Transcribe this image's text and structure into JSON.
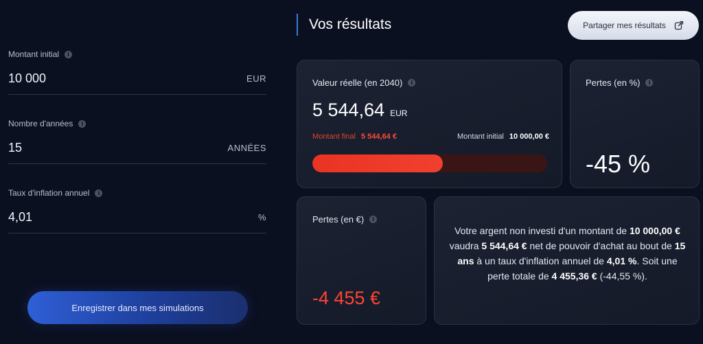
{
  "form": {
    "fields": [
      {
        "label": "Montant initial",
        "value": "10 000",
        "unit": "EUR"
      },
      {
        "label": "Nombre d'années",
        "value": "15",
        "unit": "ANNÉES"
      },
      {
        "label": "Taux d'inflation annuel",
        "value": "4,01",
        "unit": "%"
      }
    ],
    "save_button": "Enregistrer dans mes simulations"
  },
  "results": {
    "title": "Vos résultats",
    "share_button": "Partager mes résultats",
    "real_value": {
      "label": "Valeur réelle (en 2040)",
      "value": "5 544,64",
      "unit": "EUR",
      "final_label": "Montant final",
      "final_value": "5 544,64 €",
      "initial_label": "Montant initial",
      "initial_value": "10 000,00 €",
      "progress_percent": 55.45
    },
    "loss_percent": {
      "label": "Pertes (en %)",
      "value": "-45 %"
    },
    "loss_eur": {
      "label": "Pertes (en €)",
      "value": "-4 455 €"
    },
    "summary": {
      "t1": "Votre argent non investi d'un montant de",
      "amount": "10 000,00 €",
      "t2": "vaudra",
      "real": "5 544,64 €",
      "t3": "net de pouvoir d'achat au bout de",
      "years": "15 ans",
      "t4": "à un taux d'inflation annuel de",
      "rate": "4,01 %",
      "t5": ". Soit une perte totale de",
      "loss": "4 455,36 €",
      "t6": "(-44,55 %)."
    }
  },
  "colors": {
    "accent_red": "#f1402f",
    "accent_blue": "#2f5fd6",
    "bg": "#0b1020"
  },
  "icons": {
    "info": "info-icon",
    "share": "share-icon"
  }
}
